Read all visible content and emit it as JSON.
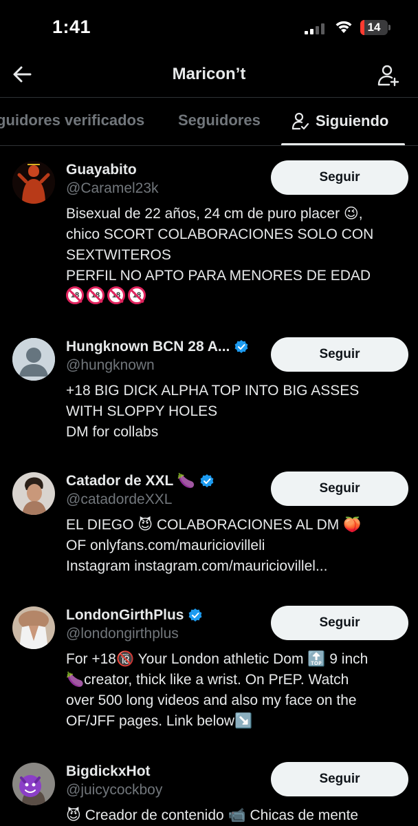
{
  "status_bar": {
    "time": "1:41",
    "battery": "14",
    "battery_level": 0.14
  },
  "nav": {
    "title": "Maricon’t"
  },
  "tabs": [
    {
      "label": "guidores verificados"
    },
    {
      "label": "Seguidores"
    },
    {
      "label": "Siguiendo"
    }
  ],
  "users": [
    {
      "name": "Guayabito",
      "handle": "@Caramel23k",
      "verified": false,
      "button": "Seguir",
      "bio": "Bisexual de 22 años, 24 cm de puro placer 😉,\nchico SCORT COLABORACIONES SOLO CON\nSEXTWITEROS\nPERFIL NO APTO PARA MENORES DE EDAD",
      "bio_badges": [
        "18",
        "18",
        "18",
        "18"
      ]
    },
    {
      "name": "Hungknown BCN 28 A...",
      "handle": "@hungknown",
      "verified": true,
      "button": "Seguir",
      "bio": "+18 BIG DICK ALPHA TOP INTO BIG ASSES\nWITH SLOPPY HOLES\nDM for collabs"
    },
    {
      "name": "Catador de XXL 🍆",
      "handle": "@catadordeXXL",
      "verified": true,
      "button": "Seguir",
      "bio": "EL DIEGO 😈 COLABORACIONES AL DM 🍑\nOF onlyfans.com/mauriciovilleli\nInstagram instagram.com/mauriciovillel..."
    },
    {
      "name": "LondonGirthPlus",
      "handle": "@londongirthplus",
      "verified": true,
      "button": "Seguir",
      "bio": "For +18🔞 Your London athletic Dom 🔝 9 inch\n🍆creator, thick like a wrist. On PrEP. Watch\nover 500 long videos and also my face on the\nOF/JFF pages. Link below↘️"
    },
    {
      "name": "BigdickxHot",
      "handle": "@juicycockboy",
      "verified": false,
      "button": "Seguir",
      "bio": "😈 Creador de contenido 📹 Chicas de mente"
    }
  ],
  "colors": {
    "accent": "#1d9bf0",
    "background": "#000000",
    "muted": "#71767b",
    "text": "#e7e9ea",
    "button_bg": "#eff3f4"
  }
}
